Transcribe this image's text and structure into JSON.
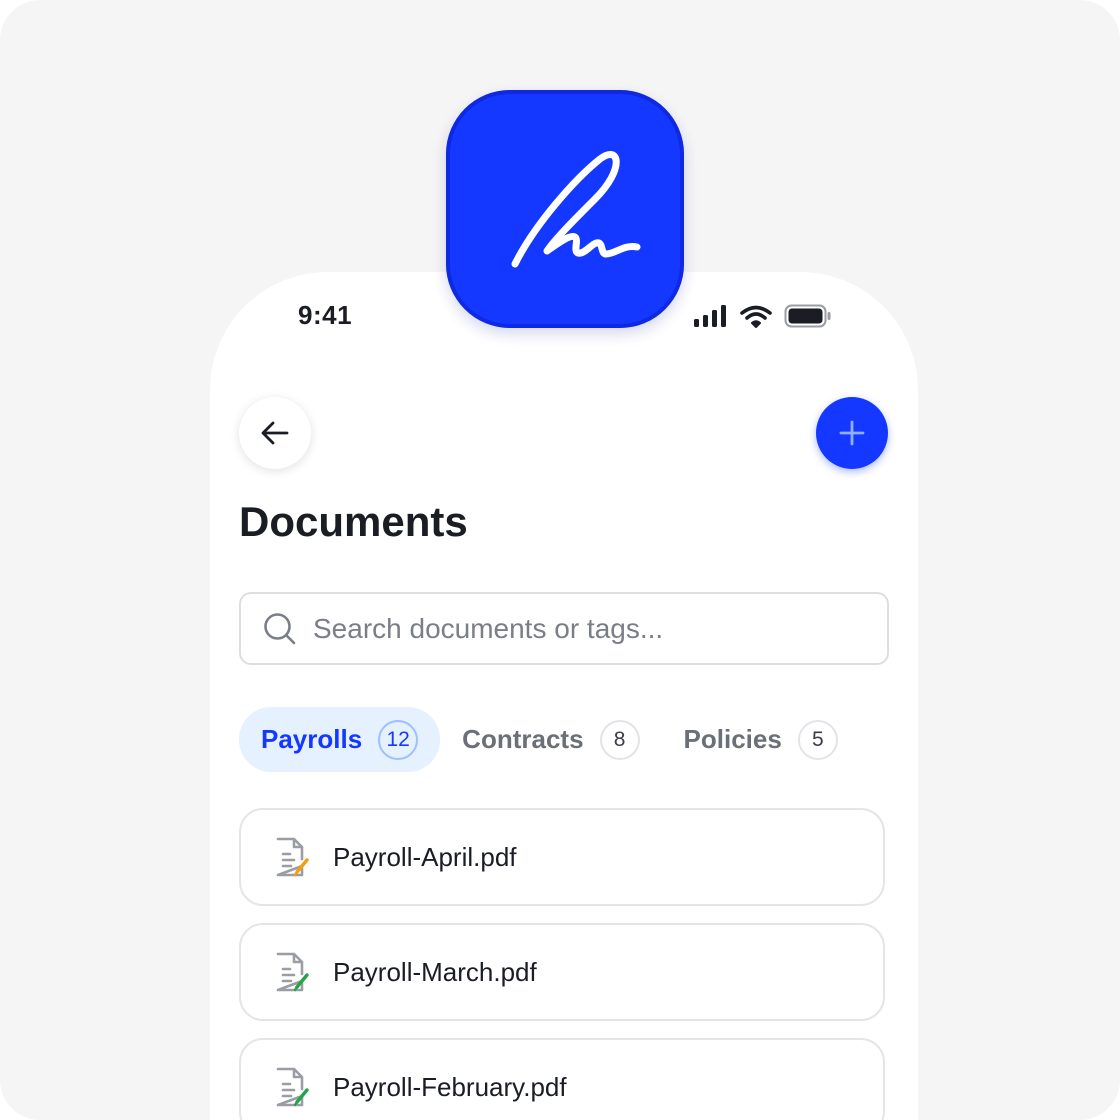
{
  "status_bar": {
    "time": "9:41"
  },
  "header": {
    "title": "Documents",
    "back_icon": "arrow-left-icon",
    "add_icon": "plus-icon"
  },
  "search": {
    "placeholder": "Search documents or tags...",
    "value": ""
  },
  "tabs": [
    {
      "label": "Payrolls",
      "count": "12",
      "active": true
    },
    {
      "label": "Contracts",
      "count": "8",
      "active": false
    },
    {
      "label": "Policies",
      "count": "5",
      "active": false
    }
  ],
  "documents": [
    {
      "name": "Payroll-April.pdf",
      "status_icon": "file-edit-icon",
      "status_color": "#f59e0b"
    },
    {
      "name": "Payroll-March.pdf",
      "status_icon": "file-signed-icon",
      "status_color": "#22a447"
    },
    {
      "name": "Payroll-February.pdf",
      "status_icon": "file-signed-icon",
      "status_color": "#22a447"
    }
  ],
  "colors": {
    "accent": "#1438ff",
    "active_tab_bg": "#e6f1ff",
    "background": "#f5f5f5"
  }
}
